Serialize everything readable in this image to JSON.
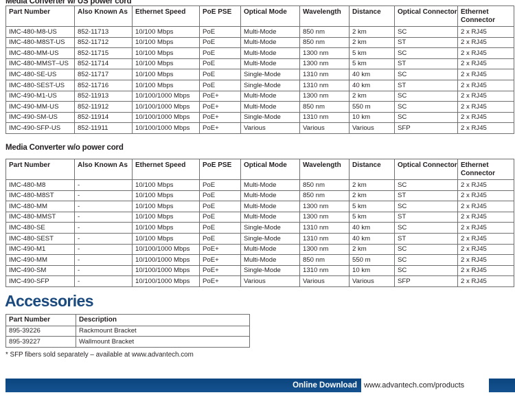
{
  "sections": {
    "table1_title": "Media Converter w/ US power cord",
    "table2_title": "Media Converter w/o power cord",
    "accessories_title": "Accessories"
  },
  "spec_columns": [
    "Part Number",
    "Also Known As",
    "Ethernet Speed",
    "PoE PSE",
    "Optical Mode",
    "Wavelength",
    "Distance",
    "Optical Connector",
    "Ethernet Connector"
  ],
  "table_power_cord": {
    "rows": [
      [
        "IMC-480-M8-US",
        "852-11713",
        "10/100 Mbps",
        "PoE",
        "Multi-Mode",
        "850 nm",
        "2 km",
        "SC",
        "2 x RJ45"
      ],
      [
        "IMC-480-M8ST-US",
        "852-11712",
        "10/100 Mbps",
        "PoE",
        "Multi-Mode",
        "850 nm",
        "2 km",
        "ST",
        "2 x RJ45"
      ],
      [
        "IMC-480-MM-US",
        "852-11715",
        "10/100 Mbps",
        "PoE",
        "Multi-Mode",
        "1300 nm",
        "5 km",
        "SC",
        "2 x RJ45"
      ],
      [
        "IMC-480-MMST–US",
        "852-11714",
        "10/100 Mbps",
        "PoE",
        "Multi-Mode",
        "1300 nm",
        "5 km",
        "ST",
        "2 x RJ45"
      ],
      [
        "IMC-480-SE-US",
        "852-11717",
        "10/100 Mbps",
        "PoE",
        "Single-Mode",
        "1310 nm",
        "40 km",
        "SC",
        "2 x RJ45"
      ],
      [
        "IMC-480-SEST-US",
        "852-11716",
        "10/100 Mbps",
        "PoE",
        "Single-Mode",
        "1310 nm",
        "40 km",
        "ST",
        "2 x RJ45"
      ],
      [
        "IMC-490-M1-US",
        "852-11913",
        "10/100/1000 Mbps",
        "PoE+",
        "Multi-Mode",
        "1300 nm",
        "2 km",
        "SC",
        "2 x RJ45"
      ],
      [
        "IMC-490-MM-US",
        "852-11912",
        "10/100/1000 Mbps",
        "PoE+",
        "Multi-Mode",
        "850 nm",
        "550 m",
        "SC",
        "2 x RJ45"
      ],
      [
        "IMC-490-SM-US",
        "852-11914",
        "10/100/1000 Mbps",
        "PoE+",
        "Single-Mode",
        "1310 nm",
        "10 km",
        "SC",
        "2 x RJ45"
      ],
      [
        "IMC-490-SFP-US",
        "852-11911",
        "10/100/1000 Mbps",
        "PoE+",
        "Various",
        "Various",
        "Various",
        "SFP",
        "2 x RJ45"
      ]
    ]
  },
  "table_no_power_cord": {
    "rows": [
      [
        "IMC-480-M8",
        "-",
        "10/100 Mbps",
        "PoE",
        "Multi-Mode",
        "850 nm",
        "2 km",
        "SC",
        "2 x RJ45"
      ],
      [
        "IMC-480-M8ST",
        "-",
        "10/100 Mbps",
        "PoE",
        "Multi-Mode",
        "850 nm",
        "2 km",
        "ST",
        "2 x RJ45"
      ],
      [
        "IMC-480-MM",
        "-",
        "10/100 Mbps",
        "PoE",
        "Multi-Mode",
        "1300 nm",
        "5 km",
        "SC",
        "2 x RJ45"
      ],
      [
        "IMC-480-MMST",
        "-",
        "10/100 Mbps",
        "PoE",
        "Multi-Mode",
        "1300 nm",
        "5 km",
        "ST",
        "2 x RJ45"
      ],
      [
        "IMC-480-SE",
        "-",
        "10/100 Mbps",
        "PoE",
        "Single-Mode",
        "1310 nm",
        "40 km",
        "SC",
        "2 x RJ45"
      ],
      [
        "IMC-480-SEST",
        "-",
        "10/100 Mbps",
        "PoE",
        "Single-Mode",
        "1310 nm",
        "40 km",
        "ST",
        "2 x RJ45"
      ],
      [
        "IMC-490-M1",
        "-",
        "10/100/1000 Mbps",
        "PoE+",
        "Multi-Mode",
        "1300 nm",
        "2 km",
        "SC",
        "2 x RJ45"
      ],
      [
        "IMC-490-MM",
        "-",
        "10/100/1000 Mbps",
        "PoE+",
        "Multi-Mode",
        "850 nm",
        "550 m",
        "SC",
        "2 x RJ45"
      ],
      [
        "IMC-490-SM",
        "-",
        "10/100/1000 Mbps",
        "PoE+",
        "Single-Mode",
        "1310 nm",
        "10 km",
        "SC",
        "2 x RJ45"
      ],
      [
        "IMC-490-SFP",
        "-",
        "10/100/1000 Mbps",
        "PoE+",
        "Various",
        "Various",
        "Various",
        "SFP",
        "2 x RJ45"
      ]
    ]
  },
  "accessories": {
    "columns": [
      "Part Number",
      "Description"
    ],
    "rows": [
      [
        "895-39226",
        "Rackmount Bracket"
      ],
      [
        "895-39227",
        "Wallmount Bracket"
      ]
    ]
  },
  "footnote": "* SFP fibers sold separately – available at www.advantech.com",
  "footer": {
    "label": "Online Download",
    "url": "www.advantech.com/products"
  },
  "colors": {
    "accent_blue": "#1b4a7f",
    "footer_bar": "#0f4c8a",
    "table_border": "#6f6f6f",
    "text": "#231f20"
  }
}
